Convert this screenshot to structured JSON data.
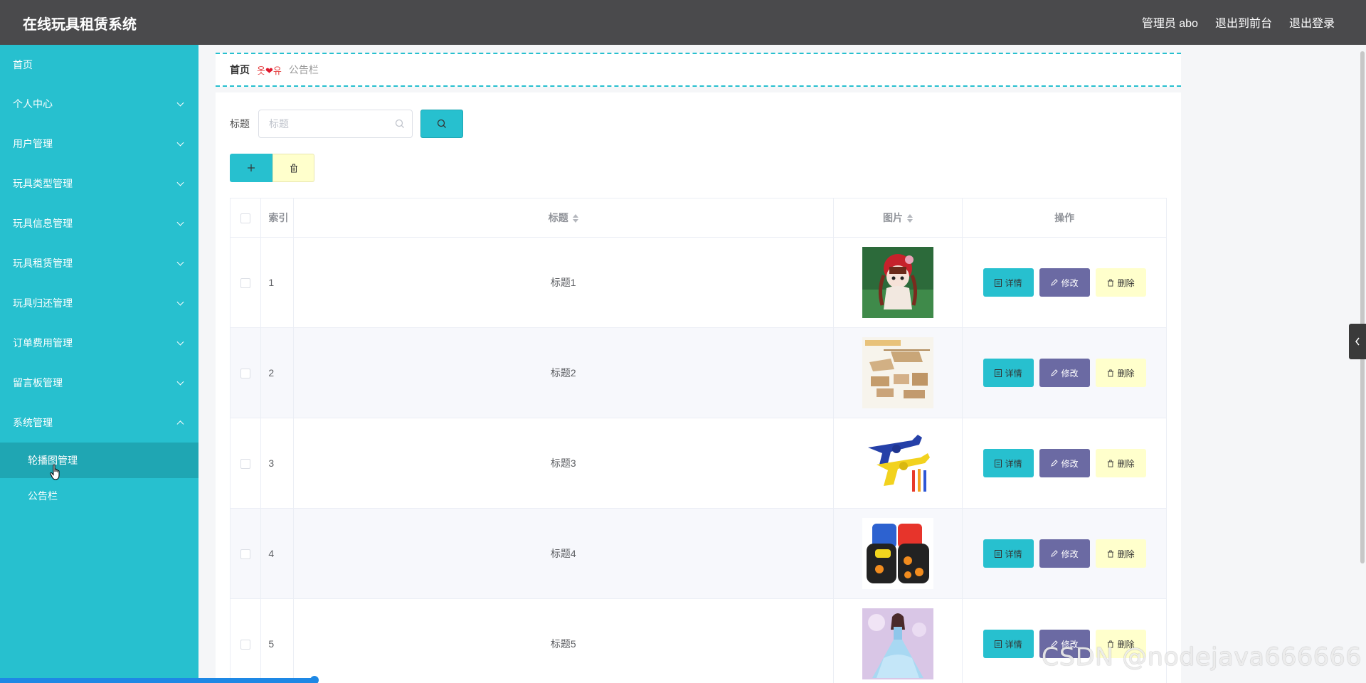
{
  "header": {
    "app_title": "在线玩具租赁系统",
    "links": [
      "管理员 abo",
      "退出到前台",
      "退出登录"
    ]
  },
  "sidebar": {
    "home": "首页",
    "items": [
      {
        "label": "个人中心",
        "expanded": false
      },
      {
        "label": "用户管理",
        "expanded": false
      },
      {
        "label": "玩具类型管理",
        "expanded": false
      },
      {
        "label": "玩具信息管理",
        "expanded": false
      },
      {
        "label": "玩具租赁管理",
        "expanded": false
      },
      {
        "label": "玩具归还管理",
        "expanded": false
      },
      {
        "label": "订单费用管理",
        "expanded": false
      },
      {
        "label": "留言板管理",
        "expanded": false
      },
      {
        "label": "系统管理",
        "expanded": true
      }
    ],
    "subitems": [
      {
        "label": "轮播图管理",
        "active": true
      },
      {
        "label": "公告栏",
        "active": false
      }
    ]
  },
  "breadcrumb": {
    "home": "首页",
    "separator_left": "옷",
    "separator_right": "유",
    "current": "公告栏"
  },
  "search": {
    "label": "标题",
    "placeholder": "标题",
    "value": ""
  },
  "table": {
    "columns": [
      "索引",
      "标题",
      "图片",
      "操作"
    ],
    "rows": [
      {
        "index": "1",
        "title": "标题1",
        "image": "rag-doll-toy"
      },
      {
        "index": "2",
        "title": "标题2",
        "image": "wooden-vehicle-models"
      },
      {
        "index": "3",
        "title": "标题3",
        "image": "toy-dart-guns"
      },
      {
        "index": "4",
        "title": "标题4",
        "image": "foam-toy-blocks"
      },
      {
        "index": "5",
        "title": "标题5",
        "image": "princess-doll"
      }
    ],
    "actions": {
      "detail": "详情",
      "edit": "修改",
      "delete": "删除"
    }
  },
  "watermark": "CSDN @nodejava666666",
  "colors": {
    "topbar": "#4a4a4c",
    "sidebar": "#27c0cf",
    "sidebar_active": "#1fa6b3",
    "edit_button": "#6b6aa3",
    "delete_button": "#ffffcc"
  }
}
